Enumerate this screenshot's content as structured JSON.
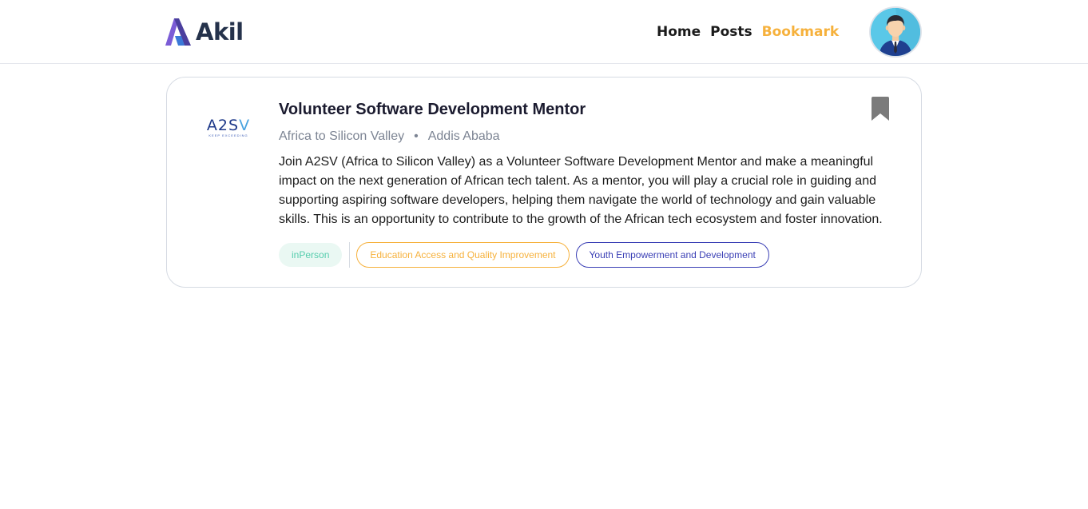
{
  "brand": {
    "name": "Akil"
  },
  "nav": {
    "items": [
      {
        "label": "Home",
        "active": false
      },
      {
        "label": "Posts",
        "active": false
      },
      {
        "label": "Bookmark",
        "active": true
      }
    ],
    "accent_color": "#F6B13C"
  },
  "job": {
    "title": "Volunteer Software Development Mentor",
    "company": "Africa to Silicon Valley",
    "location": "Addis Ababa",
    "logo": {
      "text_a": "A2S",
      "text_b": "V",
      "tagline": "KEEP EXCEEDING"
    },
    "description": "Join A2SV (Africa to Silicon Valley) as a Volunteer Software Development Mentor and make a meaningful impact on the next generation of African tech talent. As a mentor, you will play a crucial role in guiding and supporting aspiring software developers, helping them navigate the world of technology and gain valuable skills. This is an opportunity to contribute to the growth of the African tech ecosystem and foster innovation.",
    "opType": "inPerson",
    "categories": [
      "Education Access and Quality Improvement",
      "Youth Empowerment and Development"
    ],
    "bookmarked": true
  },
  "icons": {
    "logo": "akil-logo-icon",
    "avatar": "user-avatar",
    "bookmark": "bookmark-icon"
  }
}
